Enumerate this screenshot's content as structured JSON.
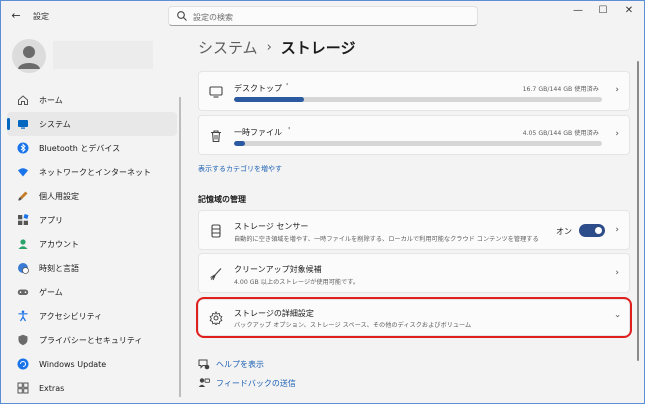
{
  "window": {
    "app_title": "設定",
    "back_label": "←",
    "controls": {
      "minimize": "—",
      "maximize": "☐",
      "close": "✕"
    }
  },
  "search": {
    "placeholder": "設定の検索"
  },
  "sidebar": {
    "items": [
      {
        "label": "ホーム",
        "icon": "home-icon"
      },
      {
        "label": "システム",
        "icon": "system-icon",
        "active": true
      },
      {
        "label": "Bluetooth とデバイス",
        "icon": "bluetooth-icon"
      },
      {
        "label": "ネットワークとインターネット",
        "icon": "network-icon"
      },
      {
        "label": "個人用設定",
        "icon": "personalization-icon"
      },
      {
        "label": "アプリ",
        "icon": "apps-icon"
      },
      {
        "label": "アカウント",
        "icon": "account-icon"
      },
      {
        "label": "時刻と言語",
        "icon": "time-language-icon"
      },
      {
        "label": "ゲーム",
        "icon": "gaming-icon"
      },
      {
        "label": "アクセシビリティ",
        "icon": "accessibility-icon"
      },
      {
        "label": "プライバシーとセキュリティ",
        "icon": "privacy-icon"
      },
      {
        "label": "Windows Update",
        "icon": "windows-update-icon"
      },
      {
        "label": "Extras",
        "icon": "extras-icon"
      }
    ]
  },
  "breadcrumb": {
    "parent": "システム",
    "separator": "›",
    "current": "ストレージ"
  },
  "storage_items": [
    {
      "title": "デスクトップ",
      "usage": "16.7 GB/144 GB 使用済み",
      "fill_fraction": 0.19,
      "tick": "'"
    },
    {
      "title": "一時ファイル",
      "usage": "4.05 GB/144 GB 使用済み",
      "fill_fraction": 0.03,
      "tick": "'"
    }
  ],
  "show_more_link": "表示するカテゴリを増やす",
  "management_heading": "記憶域の管理",
  "management_items": [
    {
      "title": "ストレージ センサー",
      "subtitle": "自動的に空き領域を増やす、一時ファイルを削除する、ローカルで利用可能なクラウド コンテンツを管理する",
      "toggle_label": "オン",
      "toggle_on": true,
      "icon": "storage-sense-icon"
    },
    {
      "title": "クリーンアップ対象候補",
      "subtitle": "4.00 GB 以上のストレージが使用可能です。",
      "icon": "cleanup-icon"
    },
    {
      "title": "ストレージの詳細設定",
      "subtitle": "バックアップ オプション、ストレージ スペース、その他のディスクおよびボリューム",
      "icon": "gear-icon"
    }
  ],
  "footer": {
    "help": "ヘルプを表示",
    "feedback": "フィードバックの送信"
  },
  "colors": {
    "accent": "#0067c0",
    "highlight": "#e01e1e",
    "bar_fill": "#2c5aa0"
  }
}
